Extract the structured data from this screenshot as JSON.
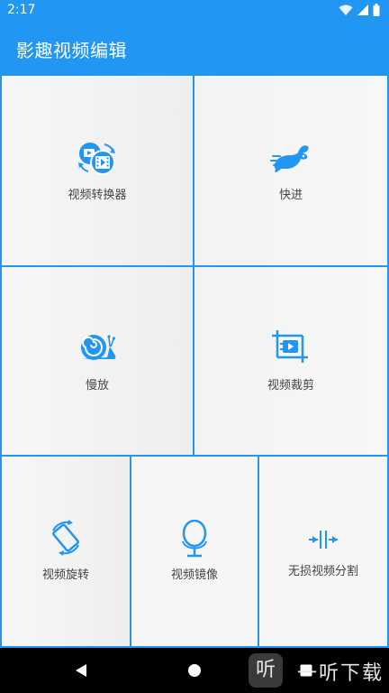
{
  "status_bar": {
    "time": "2:17",
    "icons": [
      "wifi-icon",
      "signal-icon",
      "battery-icon"
    ]
  },
  "app_bar": {
    "title": "影趣视频编辑"
  },
  "tools": [
    {
      "label": "视频转换器",
      "icon": "video-converter-icon"
    },
    {
      "label": "快进",
      "icon": "rabbit-icon"
    },
    {
      "label": "慢放",
      "icon": "snail-icon"
    },
    {
      "label": "视频裁剪",
      "icon": "video-crop-icon"
    },
    {
      "label": "视频旋转",
      "icon": "rotate-icon"
    },
    {
      "label": "视频镜像",
      "icon": "mirror-icon"
    },
    {
      "label": "无损视频分割",
      "icon": "split-icon"
    }
  ],
  "nav_bar": {
    "icons": [
      "back-icon",
      "home-icon",
      "recent-apps-icon"
    ]
  },
  "watermark": {
    "text": "一听下载",
    "logo_text": "听"
  },
  "colors": {
    "primary": "#2196F3",
    "tile_bg": "#f6f6f6",
    "label": "#444444",
    "nav_bar": "#000000"
  }
}
